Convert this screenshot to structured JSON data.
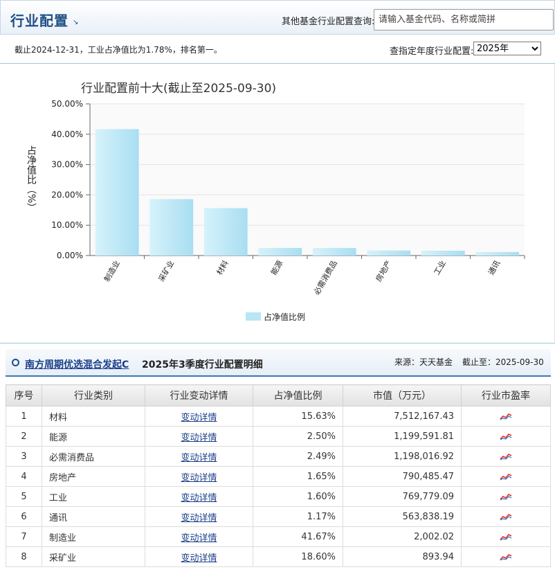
{
  "header": {
    "title": "行业配置",
    "title_arrow": "↘",
    "query_label": "其他基金行业配置查询:",
    "search_placeholder": "请输入基金代码、名称或简拼"
  },
  "infobar": {
    "note": "截止2024-12-31，工业占净值比为1.78%，排名第一。",
    "year_label": "查指定年度行业配置:",
    "year_selected": "2025年"
  },
  "chart_data": {
    "type": "bar",
    "title": "行业配置前十大(截止至2025-09-30)",
    "ylabel": "占净值比（%）",
    "ylim": [
      0,
      50
    ],
    "yticks": [
      "0.00%",
      "10.00%",
      "20.00%",
      "30.00%",
      "40.00%",
      "50.00%"
    ],
    "categories": [
      "制造业",
      "采矿业",
      "材料",
      "能源",
      "必需消费品",
      "房地产",
      "工业",
      "通讯"
    ],
    "series": [
      {
        "name": "占净值比例",
        "values": [
          41.67,
          18.6,
          15.63,
          2.5,
          2.49,
          1.65,
          1.6,
          1.17
        ]
      }
    ],
    "legend": "bottom-center",
    "bar_color": "#b9e6f5"
  },
  "detail": {
    "fund_name": "南方周期优选混合发起C",
    "title": "2025年3季度行业配置明细",
    "source": "来源：天天基金",
    "asof": "截止至：2025-09-30",
    "columns": [
      "序号",
      "行业类别",
      "行业变动详情",
      "占净值比例",
      "市值（万元）",
      "行业市盈率"
    ],
    "rows": [
      {
        "idx": "1",
        "name": "材料",
        "link": "变动详情",
        "pct": "15.63%",
        "mv": "7,512,167.43"
      },
      {
        "idx": "2",
        "name": "能源",
        "link": "变动详情",
        "pct": "2.50%",
        "mv": "1,199,591.81"
      },
      {
        "idx": "3",
        "name": "必需消费品",
        "link": "变动详情",
        "pct": "2.49%",
        "mv": "1,198,016.92"
      },
      {
        "idx": "4",
        "name": "房地产",
        "link": "变动详情",
        "pct": "1.65%",
        "mv": "790,485.47"
      },
      {
        "idx": "5",
        "name": "工业",
        "link": "变动详情",
        "pct": "1.60%",
        "mv": "769,779.09"
      },
      {
        "idx": "6",
        "name": "通讯",
        "link": "变动详情",
        "pct": "1.17%",
        "mv": "563,838.19"
      },
      {
        "idx": "7",
        "name": "制造业",
        "link": "变动详情",
        "pct": "41.67%",
        "mv": "2,002.02"
      },
      {
        "idx": "8",
        "name": "采矿业",
        "link": "变动详情",
        "pct": "18.60%",
        "mv": "893.94"
      }
    ],
    "pe_icon": "trend-chart-icon"
  }
}
